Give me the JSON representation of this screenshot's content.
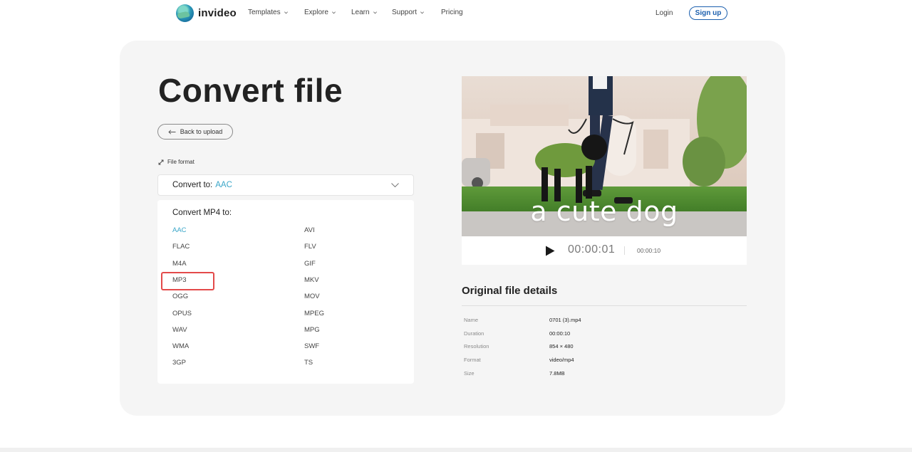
{
  "header": {
    "logo_text": "invideo",
    "nav": [
      {
        "label": "Templates",
        "has_dropdown": true
      },
      {
        "label": "Explore",
        "has_dropdown": true
      },
      {
        "label": "Learn",
        "has_dropdown": true
      },
      {
        "label": "Support",
        "has_dropdown": true
      },
      {
        "label": "Pricing",
        "has_dropdown": false
      }
    ],
    "login_label": "Login",
    "signup_label": "Sign up"
  },
  "converter": {
    "title": "Convert file",
    "back_label": "Back to upload",
    "file_format_label": "File format",
    "convert_to_label": "Convert to:",
    "convert_to_value": "AAC",
    "menu_heading": "Convert MP4 to:",
    "formats_left": [
      "AAC",
      "FLAC",
      "M4A",
      "MP3",
      "OGG",
      "OPUS",
      "WAV",
      "WMA",
      "3GP"
    ],
    "formats_right": [
      "AVI",
      "FLV",
      "GIF",
      "MKV",
      "MOV",
      "MPEG",
      "MPG",
      "SWF",
      "TS"
    ],
    "selected_format": "AAC",
    "highlighted_format": "MP3"
  },
  "video": {
    "caption": "a cute dog",
    "current_time": "00:00:01",
    "duration": "00:00:10"
  },
  "details": {
    "title": "Original file details",
    "rows": [
      {
        "key": "Name",
        "value": "0701 (3).mp4"
      },
      {
        "key": "Duration",
        "value": "00:00:10"
      },
      {
        "key": "Resolution",
        "value": "854 × 480"
      },
      {
        "key": "Format",
        "value": "video/mp4"
      },
      {
        "key": "Size",
        "value": "7.8MB"
      }
    ]
  },
  "colors": {
    "accent": "#3aa6c8",
    "signup_border": "#1b5fae",
    "highlight": "#e34a4a",
    "panel_bg": "#f5f5f5"
  }
}
